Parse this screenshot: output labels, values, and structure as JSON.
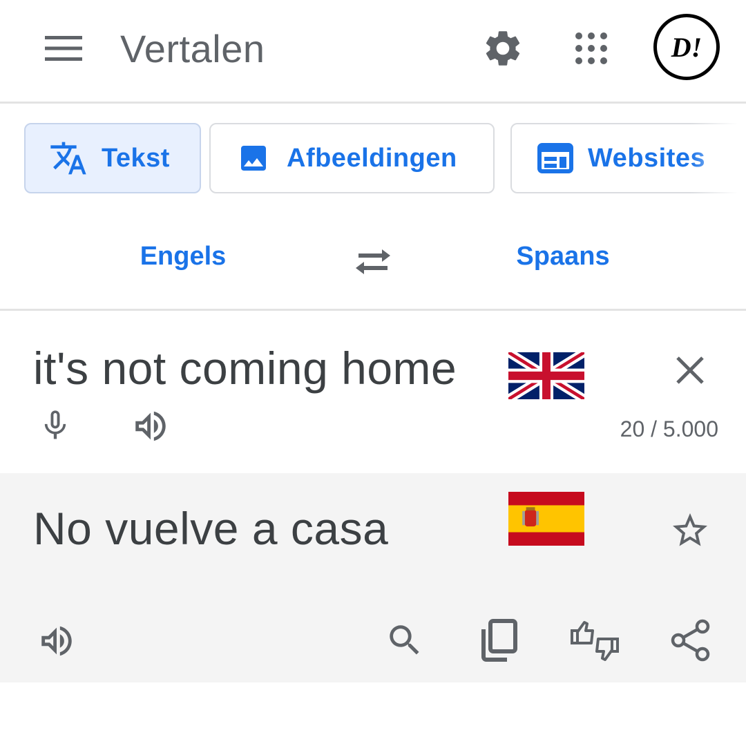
{
  "app": {
    "title": "Vertalen",
    "avatar_text": "D!"
  },
  "modes": [
    {
      "label": "Tekst",
      "icon": "translate-icon",
      "active": true
    },
    {
      "label": "Afbeeldingen",
      "icon": "image-icon",
      "active": false
    },
    {
      "label": "Websites",
      "icon": "web-icon",
      "active": false
    }
  ],
  "languages": {
    "source": "Engels",
    "target": "Spaans"
  },
  "source": {
    "text": "it's not coming home",
    "char_count": "20 / 5.000",
    "flag": "uk-flag"
  },
  "result": {
    "text": "No vuelve a casa",
    "flag": "spain-flag"
  },
  "colors": {
    "accent": "#1a73e8",
    "icon": "#5f6368",
    "active_chip_bg": "#e8f0fe",
    "result_bg": "#f4f4f4"
  }
}
